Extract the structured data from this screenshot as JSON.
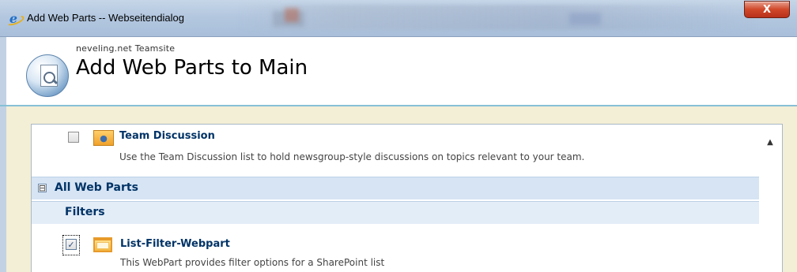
{
  "window": {
    "title": "Add Web Parts -- Webseitendialog",
    "close_label": "X"
  },
  "header": {
    "site_name": "neveling.net Teamsite",
    "page_title": "Add Web Parts to Main"
  },
  "web_parts": {
    "team_discussion": {
      "title": "Team Discussion",
      "description": "Use the Team Discussion list to hold newsgroup-style discussions on topics relevant to your team.",
      "checked": false
    },
    "list_filter": {
      "title": "List-Filter-Webpart",
      "description": "This WebPart provides filter options for a SharePoint list",
      "checked": true
    }
  },
  "groups": {
    "all_web_parts": {
      "label": "All Web Parts",
      "expander": "⊟"
    },
    "filters": {
      "label": "Filters"
    }
  },
  "scroll": {
    "up_glyph": "▲"
  },
  "colors": {
    "accent": "#003366",
    "group_band": "#d6e4f4",
    "beige": "#f3eed6"
  }
}
